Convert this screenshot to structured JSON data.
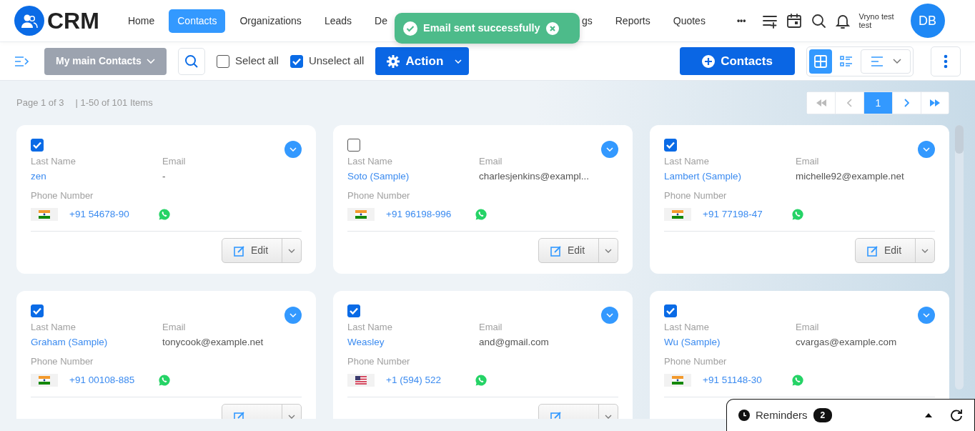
{
  "app": {
    "logo_text": "CRM"
  },
  "nav": [
    {
      "label": "Home",
      "selected": false
    },
    {
      "label": "Contacts",
      "selected": true
    },
    {
      "label": "Organizations",
      "selected": false
    },
    {
      "label": "Leads",
      "selected": false
    },
    {
      "label": "De",
      "selected": false
    },
    {
      "label": "gs",
      "selected": false
    },
    {
      "label": "Reports",
      "selected": false
    },
    {
      "label": "Quotes",
      "selected": false
    }
  ],
  "more_label": "•••",
  "user": {
    "name": "Vryno test test",
    "initials": "DB"
  },
  "toast": {
    "message": "Email sent successfully"
  },
  "toolbar": {
    "view_select": "My main Contacts",
    "checks": [
      {
        "label": "Select all",
        "checked": false
      },
      {
        "label": "Unselect all",
        "checked": true
      }
    ],
    "action_label": "Action",
    "add_label": "Contacts",
    "views": [
      {
        "kind": "grid",
        "selected": true
      },
      {
        "kind": "list",
        "selected": false
      },
      {
        "kind": "lines",
        "selected": false
      }
    ]
  },
  "pagination": {
    "page_info": "Page 1 of 3",
    "items_info": "|  1-50 of 101 Items",
    "buttons": [
      {
        "kind": "first",
        "disabled": true,
        "selected": false
      },
      {
        "kind": "prev",
        "disabled": true,
        "selected": false
      },
      {
        "kind": "page",
        "label": "1",
        "disabled": false,
        "selected": true
      },
      {
        "kind": "next",
        "disabled": false,
        "selected": false
      },
      {
        "kind": "last",
        "disabled": false,
        "selected": false
      }
    ]
  },
  "cards": [
    {
      "selected": true,
      "last_name_label": "Last Name",
      "last_name": "zen",
      "email_label": "Email",
      "email": "-",
      "phone_label": "Phone Number",
      "flag": {
        "kind": "in"
      },
      "phone": "+91 54678-90",
      "edit_button": true,
      "edit_label": "Edit"
    },
    {
      "selected": false,
      "last_name_label": "Last Name",
      "last_name": "Soto (Sample)",
      "email_label": "Email",
      "email": "charlesjenkins@exampl...",
      "phone_label": "Phone Number",
      "flag": {
        "kind": "in"
      },
      "phone": "+91 96198-996",
      "edit_button": true,
      "edit_label": "Edit"
    },
    {
      "selected": true,
      "last_name_label": "Last Name",
      "last_name": "Lambert (Sample)",
      "email_label": "Email",
      "email": "michelle92@example.net",
      "phone_label": "Phone Number",
      "flag": {
        "kind": "in"
      },
      "phone": "+91 77198-47",
      "edit_button": true,
      "edit_label": "Edit"
    },
    {
      "selected": true,
      "last_name_label": "Last Name",
      "last_name": "Graham (Sample)",
      "email_label": "Email",
      "email": "tonycook@example.net",
      "phone_label": "Phone Number",
      "flag": {
        "kind": "in"
      },
      "phone": "+91 00108-885",
      "edit_button": true
    },
    {
      "selected": true,
      "last_name_label": "Last Name",
      "last_name": "Weasley",
      "email_label": "Email",
      "email": "and@gmail.com",
      "phone_label": "Phone Number",
      "flag": {
        "kind": "us"
      },
      "phone": "+1 (594) 522",
      "edit_button": true
    },
    {
      "selected": true,
      "last_name_label": "Last Name",
      "last_name": "Wu (Sample)",
      "email_label": "Email",
      "email": "cvargas@example.com",
      "phone_label": "Phone Number",
      "flag": {
        "kind": "in"
      },
      "phone": "+91 51148-30"
    }
  ],
  "reminders": {
    "label": "Reminders",
    "count": "2"
  }
}
